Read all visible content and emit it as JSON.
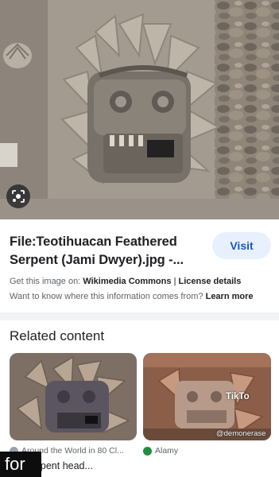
{
  "result": {
    "title": "File:Teotihuacan Feathered Serpent (Jami Dwyer).jpg -...",
    "visit_label": "Visit",
    "get_image_prefix": "Get this image on:",
    "source_name": "Wikimedia Commons",
    "separator": "|",
    "license_label": "License details",
    "info_question": "Want to know where this information comes from?",
    "learn_more": "Learn more"
  },
  "related": {
    "heading": "Related content",
    "cards": [
      {
        "source": "Around the World in 80 Cl...",
        "caption": "red serpent head..."
      },
      {
        "source": "Alamy",
        "caption": ""
      }
    ],
    "tiktok_text": "TikTo",
    "tiktok_user": "@demonerase"
  },
  "overlay": {
    "for_text": "for"
  },
  "colors": {
    "visit_bg": "#e8f0fe",
    "visit_text": "#1a56c4",
    "accent_link": "#202124"
  },
  "icons": {
    "lens": "lens-icon",
    "source_favicon": "globe-icon",
    "alamy_favicon": "alamy-icon"
  }
}
